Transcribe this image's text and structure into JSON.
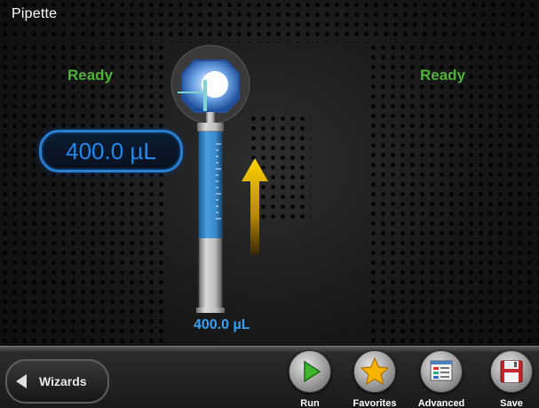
{
  "window": {
    "title": "Pipette"
  },
  "status": {
    "left": "Ready",
    "right": "Ready"
  },
  "volume": {
    "setpoint": "400.0 µL",
    "current": "400.0 µL",
    "fill_fraction": 0.6
  },
  "colors": {
    "ready": "#4fb33a",
    "accent_blue": "#1e88ef",
    "arrow": "#f2c200"
  },
  "nav": {
    "wizards_label": "Wizards"
  },
  "toolbar": [
    {
      "label": "Run",
      "icon": "play-icon"
    },
    {
      "label": "Favorites",
      "icon": "star-icon"
    },
    {
      "label": "Advanced",
      "icon": "advanced-window-icon"
    },
    {
      "label": "Save",
      "icon": "floppy-disk-icon"
    }
  ]
}
